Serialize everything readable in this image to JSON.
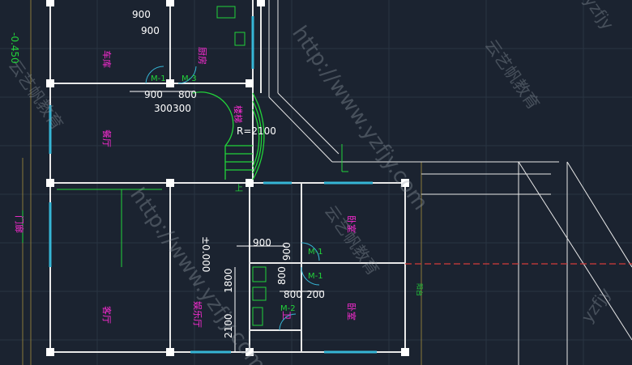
{
  "dimensions": {
    "d900_top": "900",
    "d900_top2": "900",
    "d900_mid": "900",
    "d800_mid": "800",
    "d300_a": "300",
    "d300_b": "300",
    "radius": "R=2100",
    "d900_lower": "900",
    "d900_lower_v": "900",
    "d800_lower": "800",
    "d200_lower": "200",
    "d1800": "1800",
    "d2100": "2100",
    "d800_v": "800",
    "level_minus": "-0.450",
    "level_zero": "±0.000"
  },
  "rooms": {
    "garage": "车库",
    "kitchen": "厨房",
    "dining": "餐厅",
    "stair": "楼梯",
    "living": "客厅",
    "entertainment": "娱乐厅",
    "bedroom_upper": "卧室",
    "bedroom_lower": "卧室",
    "bath": "卫"
  },
  "doors": {
    "m1": "M-1",
    "m3": "M-3",
    "m1b": "M-1",
    "m1c": "M-1",
    "m2": "M-2"
  },
  "annotations": {
    "entry": "门廊",
    "up": "上",
    "bad_label": "阳台"
  },
  "watermarks": {
    "url": "http://www.yzfjy.com",
    "brand": "云艺帆教育",
    "corner": "yzfjy"
  },
  "colors": {
    "background": "#1b2330",
    "wall": "#e8e8e8",
    "dimension": "#ffffff",
    "room_label": "#ff2bd6",
    "green": "#22d33a",
    "window": "#36b6d6",
    "red_line": "#d23b3b"
  }
}
